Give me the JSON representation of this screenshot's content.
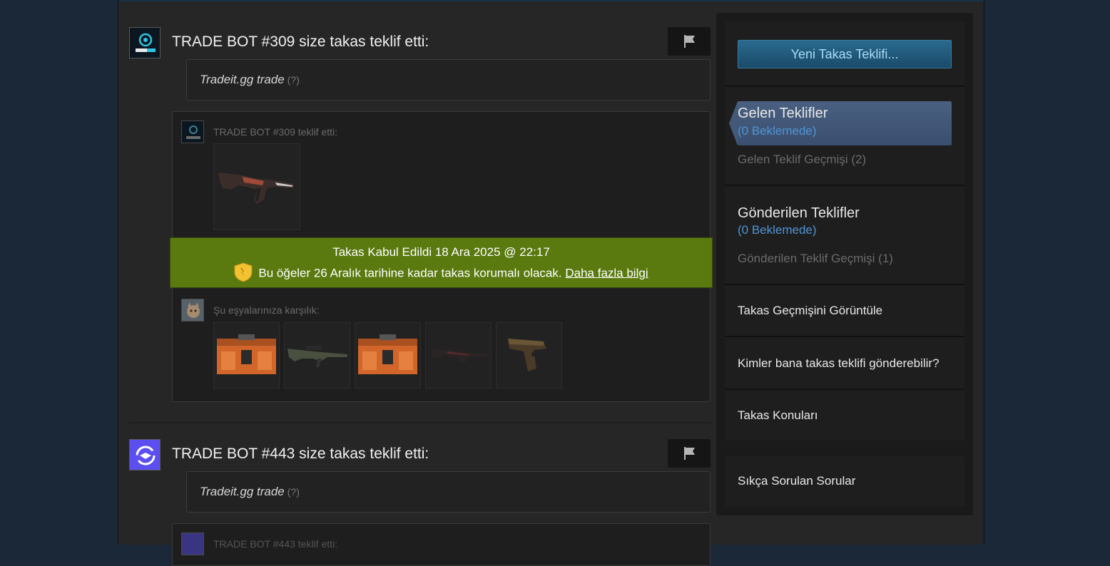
{
  "offers": [
    {
      "title": "TRADE BOT #309 size takas teklif etti:",
      "message": "Tradeit.gg trade",
      "help": "(?)",
      "offered_label": "TRADE BOT #309 teklif etti:",
      "in_return_label": "Şu eşyalarınıza karşılık:",
      "banner": {
        "line1": "Takas Kabul Edildi 18 Ara 2025 @ 22:17",
        "line2": "Bu öğeler 26 Aralık tarihine kadar takas korumalı olacak.",
        "link": "Daha fazla bilgi"
      }
    },
    {
      "title": "TRADE BOT #443 size takas teklif etti:",
      "message": "Tradeit.gg trade",
      "help": "(?)",
      "offered_label": "TRADE BOT #443 teklif etti:"
    }
  ],
  "sidebar": {
    "new_offer_button": "Yeni Takas Teklifi...",
    "incoming": {
      "title": "Gelen Teklifler",
      "pending": "(0 Beklemede)",
      "history": "Gelen Teklif Geçmişi (2)"
    },
    "sent": {
      "title": "Gönderilen Teklifler",
      "pending": "(0 Beklemede)",
      "history": "Gönderilen Teklif Geçmişi (1)"
    },
    "trade_history": "Takas Geçmişini Görüntüle",
    "who_can_send": "Kimler bana takas teklifi gönderebilir?",
    "trade_topics": "Takas Konuları",
    "faq": "Sıkça Sorulan Sorular"
  },
  "colors": {
    "accepted_banner": "#5a7a10",
    "pending_blue": "#4f94d4",
    "new_offer_button": "#2a6a8e"
  }
}
